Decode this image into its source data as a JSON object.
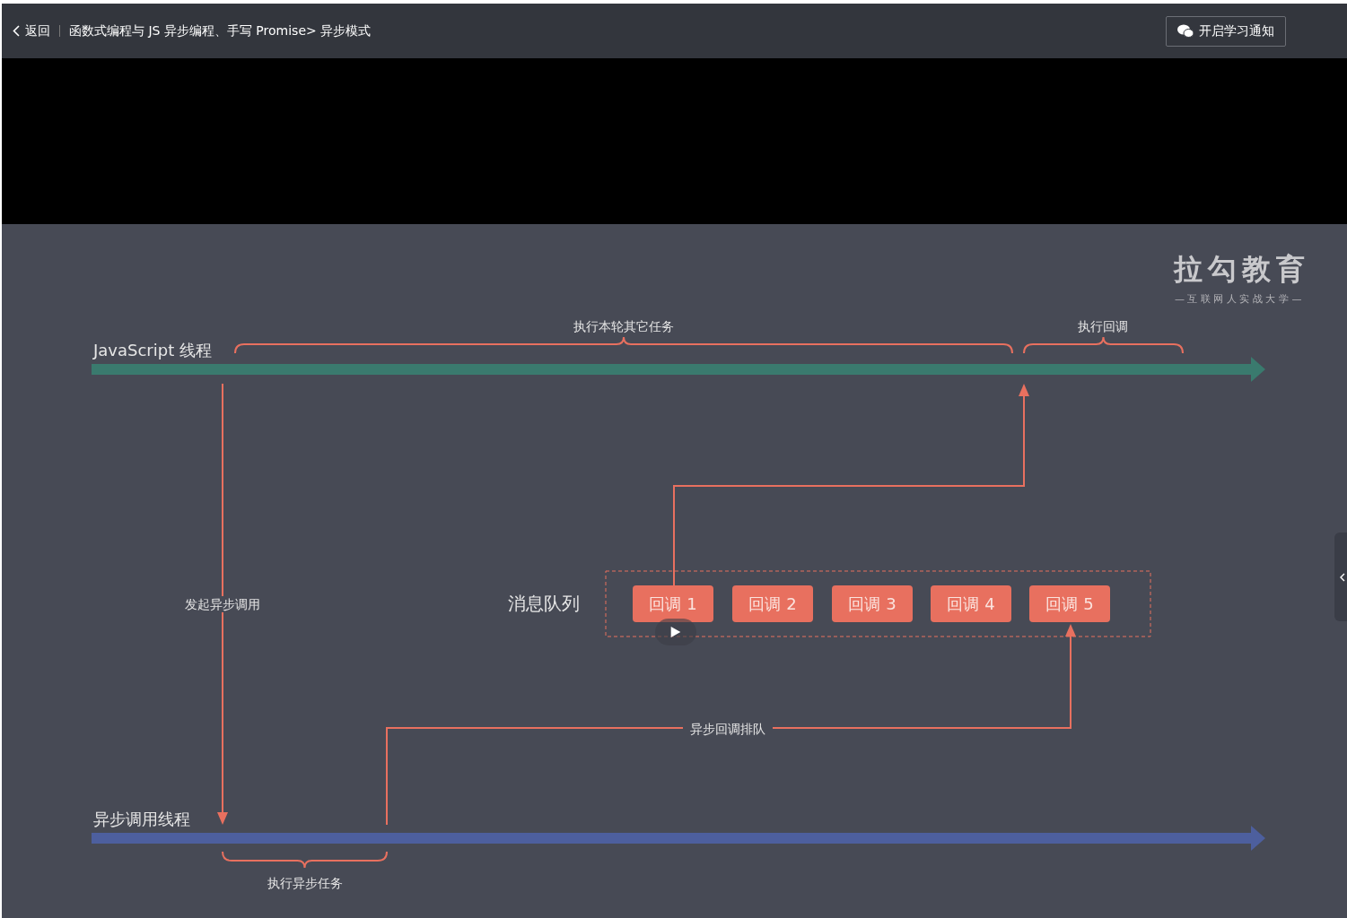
{
  "header": {
    "back_label": "返回",
    "breadcrumb": "函数式编程与 JS 异步编程、手写 Promise> 异步模式",
    "notify_button": "开启学习通知"
  },
  "slide": {
    "logo": {
      "title": "拉勾教育",
      "subtitle": "— 互 联 网 人 实 战 大 学 —"
    },
    "js_thread": {
      "label": "JavaScript 线程",
      "other_tasks": "执行本轮其它任务",
      "run_callback": "执行回调"
    },
    "async_thread": {
      "label": "异步调用线程",
      "run_async": "执行异步任务"
    },
    "start_async": "发起异步调用",
    "queue_callback": "异步回调排队",
    "queue": {
      "label": "消息队列",
      "callbacks": [
        "回调 1",
        "回调 2",
        "回调 3",
        "回调 4",
        "回调 5"
      ]
    }
  }
}
